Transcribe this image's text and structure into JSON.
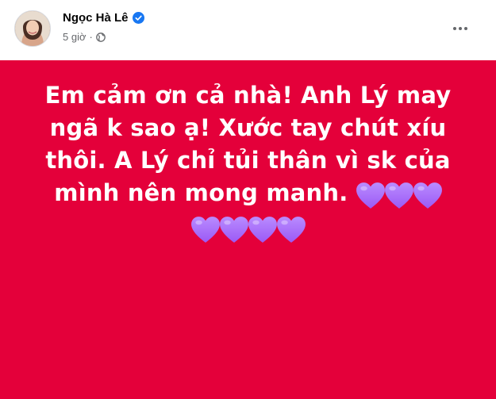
{
  "post": {
    "author": "Ngọc Hà Lê",
    "time": "5 giờ",
    "separator": "·",
    "verified": true,
    "privacy_icon": "globe-icon",
    "more_icon": "more-horizontal-icon",
    "text_lines": [
      "Em cảm ơn cả nhà! Anh Lý may",
      "ngã k sao ạ! Xước tay chút xíu",
      "thôi. A Lý chỉ tủi thân vì sk của",
      "mình nên mong manh."
    ],
    "hearts_line1": 3,
    "hearts_line2": 4,
    "colors": {
      "background": "#e4003a",
      "text": "#ffffff",
      "heart": "#9b59f5",
      "verified": "#1877f2"
    }
  }
}
